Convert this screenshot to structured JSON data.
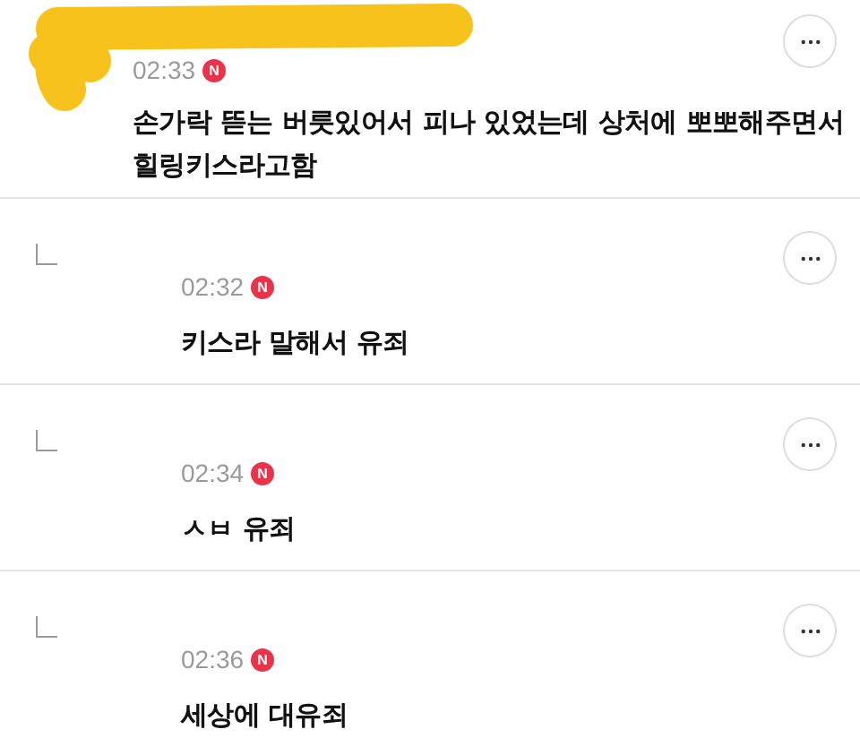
{
  "comments": [
    {
      "kind": "comment",
      "redacted": true,
      "time": "02:33",
      "badge": "N",
      "text": "손가락 뜯는 버릇있어서 피나 있었는데 상처에 뽀뽀해주면서 힐링키스라고함"
    },
    {
      "kind": "reply",
      "redacted": false,
      "time": "02:32",
      "badge": "N",
      "text": "키스라 말해서 유죄"
    },
    {
      "kind": "reply",
      "redacted": false,
      "time": "02:34",
      "badge": "N",
      "text": "ㅅㅂ 유죄"
    },
    {
      "kind": "reply",
      "redacted": false,
      "time": "02:36",
      "badge": "N",
      "text": "세상에 대유죄"
    }
  ]
}
